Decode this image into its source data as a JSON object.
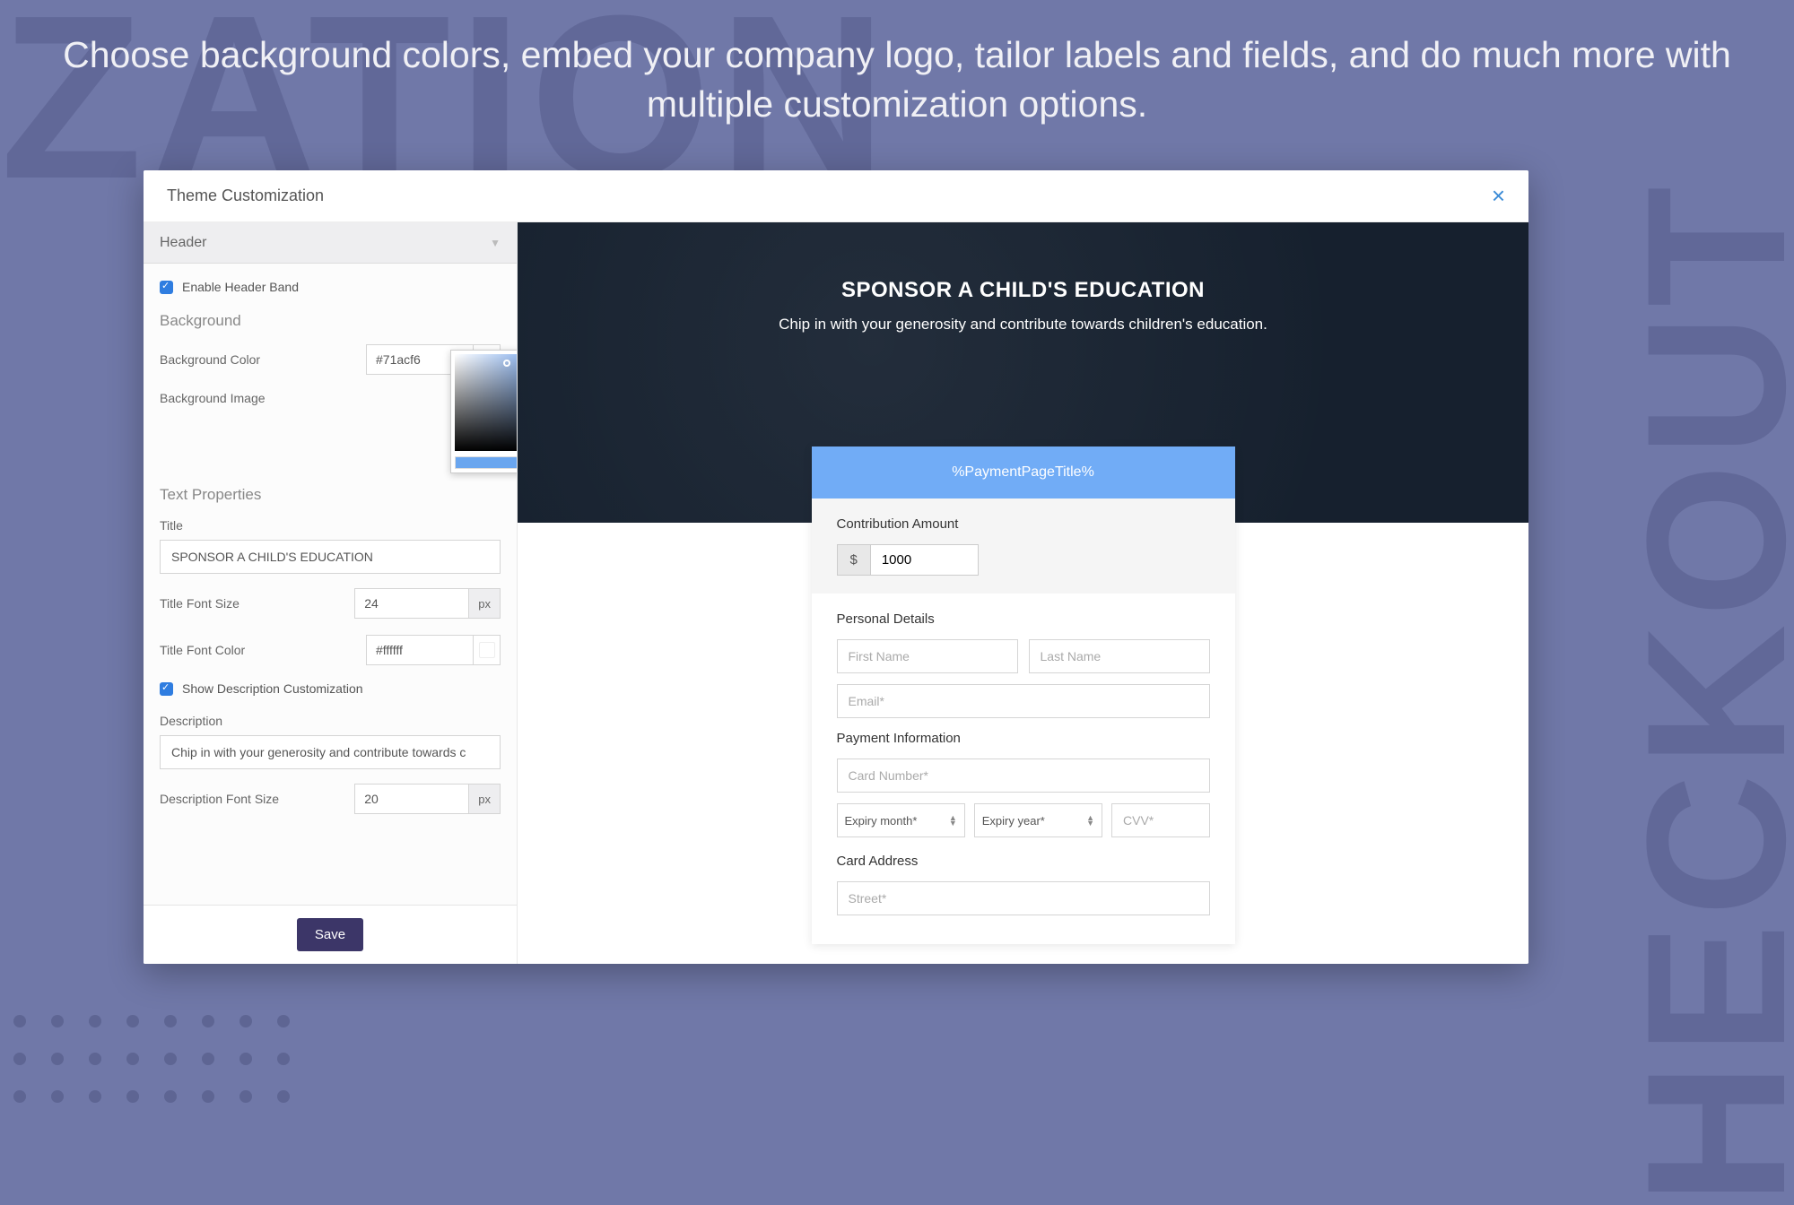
{
  "tagline": "Choose background colors, embed your company logo, tailor labels and fields, and do much more with multiple customization options.",
  "bgText": {
    "left": "IZATION",
    "right": "HECKOUT"
  },
  "modal": {
    "title": "Theme Customization",
    "dropdown": "Header",
    "enableHeaderBand": "Enable Header Band",
    "backgroundHeading": "Background",
    "bgColorLabel": "Background Color",
    "bgColorValue": "#71acf6",
    "bgImageLabel": "Background Image",
    "textPropsHeading": "Text Properties",
    "titleLabel": "Title",
    "titleValue": "SPONSOR A CHILD'S EDUCATION",
    "titleFontSizeLabel": "Title Font Size",
    "titleFontSizeValue": "24",
    "pxUnit": "px",
    "titleFontColorLabel": "Title Font Color",
    "titleFontColorValue": "#ffffff",
    "showDescLabel": "Show Description Customization",
    "descLabel": "Description",
    "descValue": "Chip in with your generosity and contribute towards c",
    "descFontSizeLabel": "Description Font Size",
    "descFontSizeValue": "20",
    "saveLabel": "Save"
  },
  "preview": {
    "heroTitle": "SPONSOR A CHILD'S EDUCATION",
    "heroSub": "Chip in with your generosity and contribute towards children's education.",
    "cardHeader": "%PaymentPageTitle%",
    "contribLabel": "Contribution Amount",
    "currency": "$",
    "amount": "1000",
    "personalLabel": "Personal Details",
    "firstName": "First Name",
    "lastName": "Last Name",
    "email": "Email*",
    "paymentLabel": "Payment Information",
    "cardNumber": "Card Number*",
    "expiryMonth": "Expiry month*",
    "expiryYear": "Expiry year*",
    "cvv": "CVV*",
    "cardAddressLabel": "Card Address",
    "street": "Street*"
  },
  "colors": {
    "swatchBg": "#71acf6",
    "swatchTitle": "#ffffff"
  }
}
